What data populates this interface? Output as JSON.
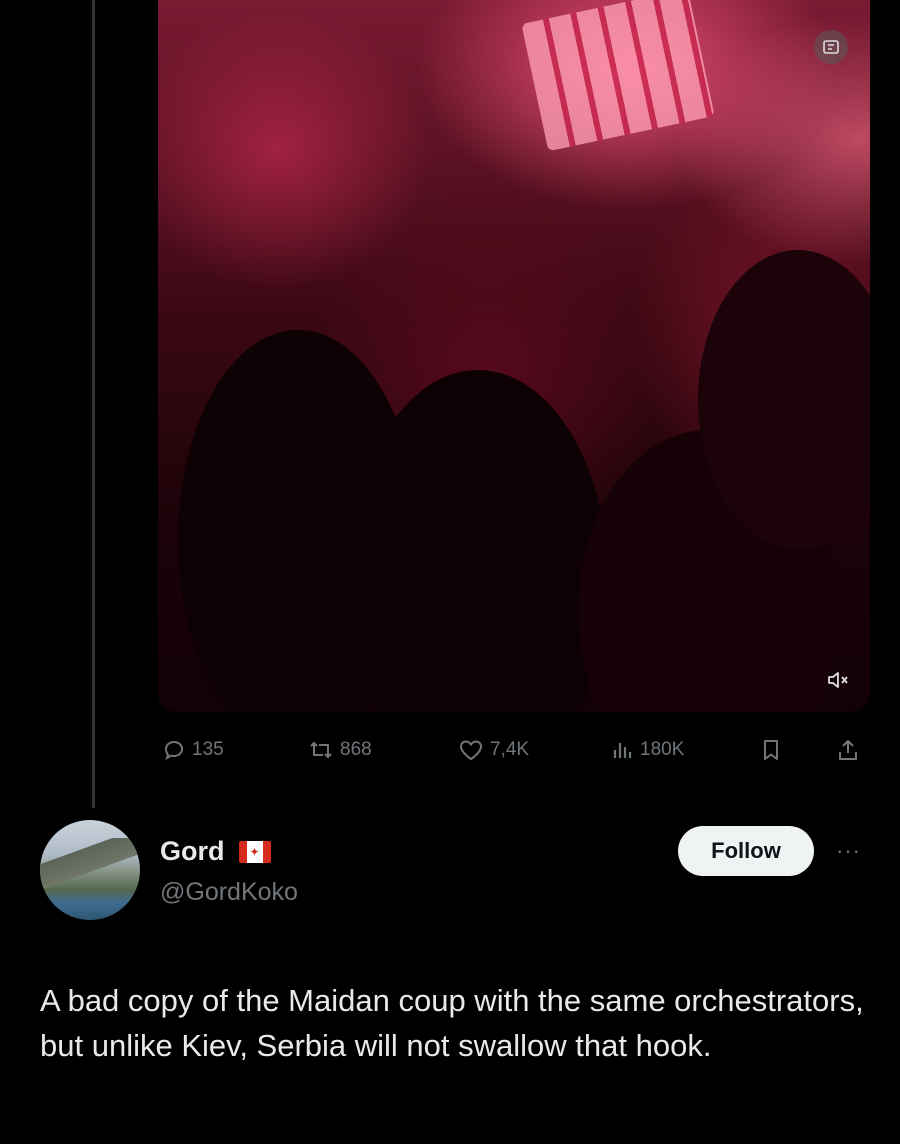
{
  "parent_tweet": {
    "media": {
      "kind": "video",
      "top_icon": "gif-settings-icon",
      "mute_icon": "speaker-muted-icon"
    },
    "actions": {
      "replies": "135",
      "reposts": "868",
      "likes": "7,4K",
      "views": "180K"
    }
  },
  "reply": {
    "author_name": "Gord",
    "author_flag": "canada-flag-icon",
    "author_handle": "@GordKoko",
    "follow_label": "Follow",
    "more_label": "···",
    "text": "A bad copy of the Maidan coup with the same orchestrators, but unlike Kiev, Serbia will not swallow that hook."
  },
  "colors": {
    "background": "#000000",
    "text": "#e7e9ea",
    "muted": "#71767b",
    "follow_bg": "#eff3f4"
  }
}
